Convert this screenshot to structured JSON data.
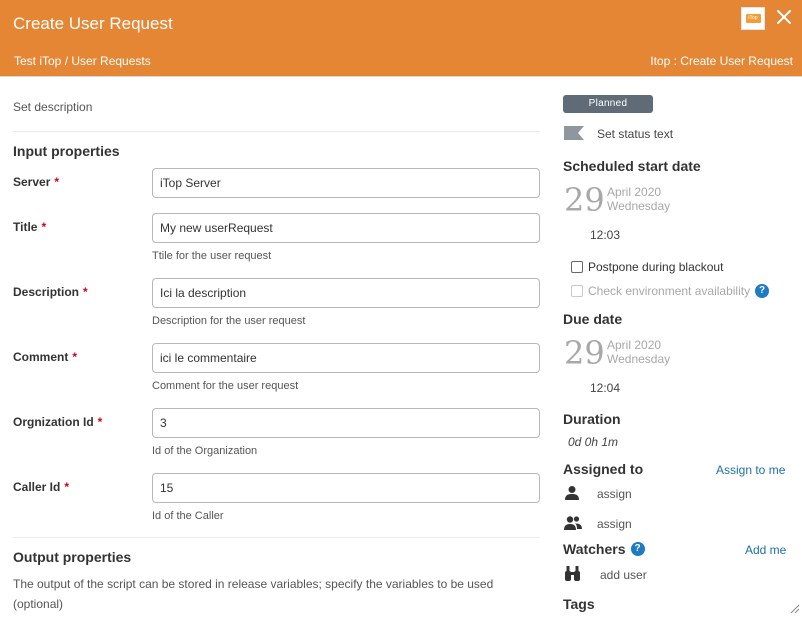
{
  "header": {
    "title": "Create User Request",
    "breadcrumb": "Test iTop / User Requests",
    "right_crumb": "Itop : Create User Request",
    "logo_text": "iTop"
  },
  "form": {
    "description_placeholder": "Set description",
    "input_section_title": "Input properties",
    "fields": [
      {
        "label": "Server",
        "value": "iTop Server",
        "hint": ""
      },
      {
        "label": "Title",
        "value": "My new userRequest",
        "hint": "Ttile for the user request"
      },
      {
        "label": "Description",
        "value": "Ici la description",
        "hint": "Description for the user request"
      },
      {
        "label": "Comment",
        "value": "ici le commentaire",
        "hint": "Comment for the user request"
      },
      {
        "label": "Orgnization Id",
        "value": "3",
        "hint": "Id of the Organization"
      },
      {
        "label": "Caller Id",
        "value": "15",
        "hint": "Id of the Caller"
      }
    ],
    "required_mark": "*",
    "output_section_title": "Output properties",
    "output_text": "The output of the script can be stored in release variables; specify the variables to be used (optional)"
  },
  "sidebar": {
    "status_badge": "Planned",
    "status_text": "Set status text",
    "scheduled_start": {
      "title": "Scheduled start date",
      "day": "29",
      "month_year": "April 2020",
      "weekday": "Wednesday",
      "time": "12:03"
    },
    "postpone_label": "Postpone during blackout",
    "check_env_label": "Check environment availability",
    "due_date": {
      "title": "Due date",
      "day": "29",
      "month_year": "April 2020",
      "weekday": "Wednesday",
      "time": "12:04"
    },
    "duration_title": "Duration",
    "duration_value": "0d 0h 1m",
    "assigned_title": "Assigned to",
    "assign_to_me": "Assign to me",
    "assign_user": "assign",
    "assign_team": "assign",
    "watchers_title": "Watchers",
    "add_me": "Add me",
    "add_user": "add user",
    "tags_title": "Tags"
  },
  "colors": {
    "header_bg": "#e48634",
    "badge_bg": "#5f6b76",
    "link": "#1d6fa9",
    "required": "#d0021b",
    "help_icon": "#1d7ac3"
  }
}
